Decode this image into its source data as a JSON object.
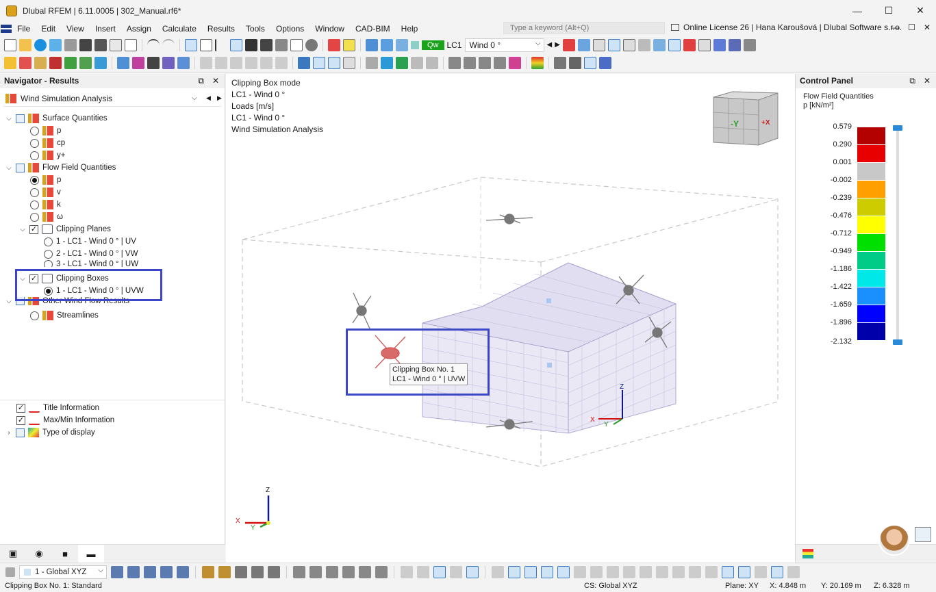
{
  "window": {
    "title": "Dlubal RFEM | 6.11.0005 | 302_Manual.rf6*",
    "controls": [
      "—",
      "☐",
      "✕"
    ]
  },
  "menu": {
    "items": [
      "File",
      "Edit",
      "View",
      "Insert",
      "Assign",
      "Calculate",
      "Results",
      "Tools",
      "Options",
      "Window",
      "CAD-BIM",
      "Help"
    ],
    "search_placeholder": "Type a keyword (Alt+Q)",
    "license": "Online License 26 | Hana Karoušová | Dlubal Software s.r.o.",
    "mdi_controls": [
      "—",
      "☐",
      "✕"
    ]
  },
  "toolbar": {
    "lc_badge": "Qw",
    "lc_id": "LC1",
    "lc_name": "Wind 0 °"
  },
  "navigator": {
    "title": "Navigator - Results",
    "header_buttons": [
      "⧉",
      "✕"
    ],
    "combo_value": "Wind Simulation Analysis",
    "tree": {
      "surface": "Surface Quantities",
      "surface_items": [
        "p",
        "cp",
        "y+"
      ],
      "flow": "Flow Field Quantities",
      "flow_items": [
        "p",
        "v",
        "k",
        "ω"
      ],
      "clipping_planes": "Clipping Planes",
      "planes": [
        "1 - LC1 - Wind 0 ° | UV",
        "2 - LC1 - Wind 0 ° | VW",
        "3 - LC1 - Wind 0 ° | UW"
      ],
      "clipping_boxes": "Clipping Boxes",
      "boxes": [
        "1 - LC1 - Wind 0 ° | UVW"
      ],
      "other": "Other Wind Flow Results",
      "streamlines": "Streamlines"
    },
    "bottom": {
      "title_info": "Title Information",
      "maxmin_info": "Max/Min Information",
      "type_display": "Type of display"
    }
  },
  "viewport": {
    "info": [
      "Clipping Box mode",
      "LC1 - Wind 0 °",
      "Loads [m/s]",
      "LC1 - Wind 0 °",
      "Wind Simulation Analysis"
    ],
    "tooltip": [
      "Clipping Box No. 1",
      "LC1 - Wind 0 ° | UVW"
    ],
    "cube_labels": [
      "-Y",
      "+X"
    ],
    "axis_labels": [
      "Z",
      "X",
      "Y"
    ]
  },
  "control_panel": {
    "title": "Control Panel",
    "header_buttons": [
      "⧉",
      "✕"
    ],
    "heading": "Flow Field Quantities",
    "unit": "p [kN/m²]",
    "legend": [
      {
        "value": "0.579",
        "color": "#b30000"
      },
      {
        "value": "0.290",
        "color": "#e80000"
      },
      {
        "value": "0.001",
        "color": "#c8c8c8"
      },
      {
        "value": "-0.002",
        "color": "#ffa000"
      },
      {
        "value": "-0.239",
        "color": "#cccc00"
      },
      {
        "value": "-0.476",
        "color": "#ffff00"
      },
      {
        "value": "-0.712",
        "color": "#00e000"
      },
      {
        "value": "-0.949",
        "color": "#00cc88"
      },
      {
        "value": "-1.186",
        "color": "#00e8e8"
      },
      {
        "value": "-1.422",
        "color": "#1a90ff"
      },
      {
        "value": "-1.659",
        "color": "#0000ff"
      },
      {
        "value": "-1.896",
        "color": "#0000aa"
      }
    ],
    "legend_last": "-2.132"
  },
  "bottombar": {
    "cs_value": "1 - Global XYZ"
  },
  "status": {
    "left": "Clipping Box No. 1: Standard",
    "cs": "CS: Global XYZ",
    "plane": "Plane: XY",
    "x": "X: 4.848 m",
    "y": "Y: 20.169 m",
    "z": "Z: 6.328 m"
  }
}
